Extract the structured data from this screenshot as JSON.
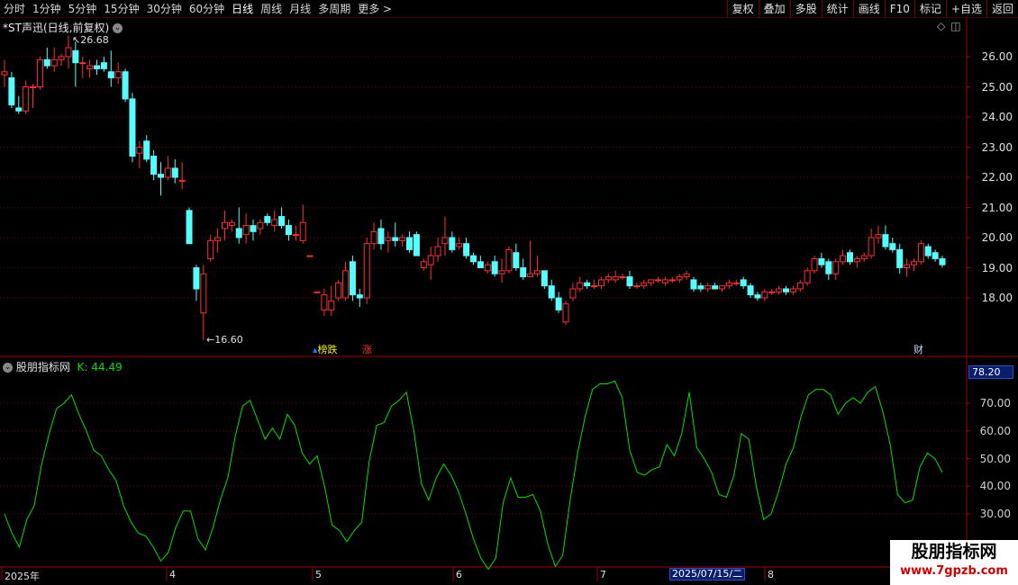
{
  "toolbar": {
    "periods": [
      "分时",
      "1分钟",
      "5分钟",
      "15分钟",
      "30分钟",
      "60分钟",
      "日线",
      "周线",
      "月线",
      "多周期",
      "更多 >"
    ],
    "active_period": "日线",
    "tools": [
      "复权",
      "叠加",
      "多股",
      "统计",
      "画线",
      "F10",
      "标记",
      "+自选",
      "返回"
    ]
  },
  "price_panel": {
    "title": "*ST声迅(日线,前复权)",
    "high_label": "26.68",
    "low_label": "16.60",
    "y_axis": [
      "26.00",
      "25.00",
      "24.00",
      "23.00",
      "22.00",
      "21.00",
      "20.00",
      "19.00",
      "18.00"
    ],
    "markers": [
      {
        "text": "榜跌",
        "color": "#f0f000"
      },
      {
        "text": "涨",
        "color": "#ff3030"
      },
      {
        "text": "财",
        "color": "#c0d8ff"
      }
    ],
    "icons": [
      "diamond-icon",
      "window-icon"
    ]
  },
  "oscillator": {
    "title": "股朋指标网",
    "series_label": "K: 44.49",
    "current_value": "78.20",
    "y_axis": [
      "70.00",
      "60.00",
      "50.00",
      "40.00",
      "30.00"
    ]
  },
  "x_axis": {
    "labels": [
      "2025年",
      "4",
      "5",
      "6",
      "7",
      "8"
    ],
    "cursor_date": "2025/07/15/二"
  },
  "watermark": {
    "title": "股朋指标网",
    "url": "www.7gpzb.com"
  },
  "chart_data": [
    {
      "type": "candlestick",
      "title": "*ST声迅(日线,前复权)",
      "ylim": [
        16.0,
        27.0
      ],
      "up_color": "#ff3030",
      "down_color": "#54ffff",
      "candles": [
        {
          "o": 25.4,
          "h": 25.9,
          "l": 25.0,
          "c": 25.5
        },
        {
          "o": 25.3,
          "h": 25.5,
          "l": 24.3,
          "c": 24.4
        },
        {
          "o": 24.3,
          "h": 24.7,
          "l": 24.1,
          "c": 24.2
        },
        {
          "o": 24.2,
          "h": 25.2,
          "l": 24.1,
          "c": 25.0
        },
        {
          "o": 25.0,
          "h": 25.1,
          "l": 24.3,
          "c": 25.0
        },
        {
          "o": 25.0,
          "h": 26.0,
          "l": 24.9,
          "c": 25.9
        },
        {
          "o": 25.9,
          "h": 26.3,
          "l": 25.6,
          "c": 25.7
        },
        {
          "o": 25.7,
          "h": 26.3,
          "l": 25.5,
          "c": 25.9
        },
        {
          "o": 25.9,
          "h": 26.1,
          "l": 25.7,
          "c": 26.0
        },
        {
          "o": 26.0,
          "h": 26.7,
          "l": 25.6,
          "c": 26.3
        },
        {
          "o": 26.2,
          "h": 26.5,
          "l": 25.0,
          "c": 25.8
        },
        {
          "o": 25.8,
          "h": 26.0,
          "l": 25.3,
          "c": 25.8
        },
        {
          "o": 25.6,
          "h": 25.9,
          "l": 25.3,
          "c": 25.7
        },
        {
          "o": 25.7,
          "h": 25.9,
          "l": 25.4,
          "c": 25.6
        },
        {
          "o": 25.8,
          "h": 26.0,
          "l": 25.5,
          "c": 25.6
        },
        {
          "o": 25.5,
          "h": 26.2,
          "l": 25.0,
          "c": 25.3
        },
        {
          "o": 25.3,
          "h": 25.8,
          "l": 25.1,
          "c": 25.5
        },
        {
          "o": 25.5,
          "h": 25.6,
          "l": 24.5,
          "c": 24.6
        },
        {
          "o": 24.6,
          "h": 24.8,
          "l": 22.5,
          "c": 22.7
        },
        {
          "o": 22.8,
          "h": 23.2,
          "l": 22.3,
          "c": 23.0
        },
        {
          "o": 23.2,
          "h": 23.4,
          "l": 22.5,
          "c": 22.6
        },
        {
          "o": 22.7,
          "h": 22.9,
          "l": 21.9,
          "c": 22.1
        },
        {
          "o": 22.1,
          "h": 22.5,
          "l": 21.4,
          "c": 22.0
        },
        {
          "o": 22.0,
          "h": 22.7,
          "l": 21.9,
          "c": 22.3
        },
        {
          "o": 22.3,
          "h": 22.6,
          "l": 21.8,
          "c": 22.0
        },
        {
          "o": 21.9,
          "h": 22.5,
          "l": 21.6,
          "c": 21.9
        },
        {
          "o": 20.9,
          "h": 21.0,
          "l": 19.8,
          "c": 19.8
        },
        {
          "o": 19.0,
          "h": 19.1,
          "l": 17.9,
          "c": 18.3
        },
        {
          "o": 17.5,
          "h": 19.1,
          "l": 16.6,
          "c": 18.8
        },
        {
          "o": 19.3,
          "h": 20.1,
          "l": 19.2,
          "c": 19.9
        },
        {
          "o": 19.9,
          "h": 20.3,
          "l": 19.5,
          "c": 20.0
        },
        {
          "o": 20.3,
          "h": 20.9,
          "l": 19.9,
          "c": 20.5
        },
        {
          "o": 20.4,
          "h": 20.6,
          "l": 20.2,
          "c": 20.5
        },
        {
          "o": 20.3,
          "h": 21.0,
          "l": 19.8,
          "c": 20.0
        },
        {
          "o": 20.1,
          "h": 20.8,
          "l": 19.8,
          "c": 20.4
        },
        {
          "o": 20.4,
          "h": 20.6,
          "l": 19.9,
          "c": 20.2
        },
        {
          "o": 20.3,
          "h": 20.6,
          "l": 20.1,
          "c": 20.5
        },
        {
          "o": 20.7,
          "h": 20.8,
          "l": 20.4,
          "c": 20.5
        },
        {
          "o": 20.4,
          "h": 20.9,
          "l": 20.2,
          "c": 20.6
        },
        {
          "o": 20.7,
          "h": 21.0,
          "l": 20.3,
          "c": 20.4
        },
        {
          "o": 20.4,
          "h": 20.6,
          "l": 19.9,
          "c": 20.1
        },
        {
          "o": 20.1,
          "h": 20.4,
          "l": 19.9,
          "c": 20.1
        },
        {
          "o": 19.9,
          "h": 21.1,
          "l": 19.8,
          "c": 20.5
        },
        {
          "o": 19.4,
          "h": 19.4,
          "l": 19.4,
          "c": 19.4
        },
        {
          "o": 18.2,
          "h": 18.2,
          "l": 18.2,
          "c": 18.2
        },
        {
          "o": 17.6,
          "h": 18.3,
          "l": 17.4,
          "c": 18.1
        },
        {
          "o": 17.6,
          "h": 18.4,
          "l": 17.4,
          "c": 17.9
        },
        {
          "o": 18.0,
          "h": 18.6,
          "l": 17.9,
          "c": 18.5
        },
        {
          "o": 18.0,
          "h": 19.2,
          "l": 17.9,
          "c": 18.9
        },
        {
          "o": 19.2,
          "h": 19.4,
          "l": 17.9,
          "c": 18.1
        },
        {
          "o": 18.1,
          "h": 18.3,
          "l": 17.7,
          "c": 18.0
        },
        {
          "o": 18.0,
          "h": 20.0,
          "l": 17.8,
          "c": 19.8
        },
        {
          "o": 19.8,
          "h": 20.5,
          "l": 19.6,
          "c": 20.2
        },
        {
          "o": 20.3,
          "h": 20.6,
          "l": 19.6,
          "c": 19.8
        },
        {
          "o": 19.9,
          "h": 20.2,
          "l": 19.5,
          "c": 20.0
        },
        {
          "o": 20.0,
          "h": 20.5,
          "l": 19.7,
          "c": 19.9
        },
        {
          "o": 19.9,
          "h": 20.1,
          "l": 19.7,
          "c": 20.0
        },
        {
          "o": 20.0,
          "h": 20.2,
          "l": 19.5,
          "c": 19.6
        },
        {
          "o": 20.1,
          "h": 20.2,
          "l": 19.4,
          "c": 19.4
        },
        {
          "o": 19.0,
          "h": 19.3,
          "l": 18.9,
          "c": 19.2
        },
        {
          "o": 19.1,
          "h": 19.7,
          "l": 18.6,
          "c": 19.4
        },
        {
          "o": 19.4,
          "h": 20.0,
          "l": 19.2,
          "c": 19.7
        },
        {
          "o": 19.8,
          "h": 20.7,
          "l": 19.4,
          "c": 20.0
        },
        {
          "o": 20.0,
          "h": 20.2,
          "l": 19.5,
          "c": 19.6
        },
        {
          "o": 19.7,
          "h": 20.0,
          "l": 19.6,
          "c": 19.8
        },
        {
          "o": 19.8,
          "h": 20.0,
          "l": 19.3,
          "c": 19.4
        },
        {
          "o": 19.4,
          "h": 19.5,
          "l": 19.1,
          "c": 19.2
        },
        {
          "o": 19.2,
          "h": 19.4,
          "l": 19.0,
          "c": 19.0
        },
        {
          "o": 18.9,
          "h": 19.2,
          "l": 18.8,
          "c": 19.1
        },
        {
          "o": 19.2,
          "h": 19.4,
          "l": 18.7,
          "c": 18.8
        },
        {
          "o": 18.8,
          "h": 19.3,
          "l": 18.5,
          "c": 18.9
        },
        {
          "o": 18.9,
          "h": 19.7,
          "l": 18.8,
          "c": 19.6
        },
        {
          "o": 19.5,
          "h": 19.8,
          "l": 18.9,
          "c": 19.0
        },
        {
          "o": 19.0,
          "h": 19.3,
          "l": 18.6,
          "c": 18.7
        },
        {
          "o": 18.7,
          "h": 19.9,
          "l": 18.7,
          "c": 18.8
        },
        {
          "o": 18.8,
          "h": 19.4,
          "l": 18.7,
          "c": 18.9
        },
        {
          "o": 18.9,
          "h": 18.9,
          "l": 18.3,
          "c": 18.4
        },
        {
          "o": 18.4,
          "h": 18.6,
          "l": 17.9,
          "c": 18.0
        },
        {
          "o": 18.0,
          "h": 18.2,
          "l": 17.5,
          "c": 17.6
        },
        {
          "o": 17.2,
          "h": 17.9,
          "l": 17.1,
          "c": 17.8
        },
        {
          "o": 18.0,
          "h": 18.5,
          "l": 17.9,
          "c": 18.3
        },
        {
          "o": 18.3,
          "h": 18.7,
          "l": 18.2,
          "c": 18.5
        },
        {
          "o": 18.5,
          "h": 18.6,
          "l": 18.3,
          "c": 18.4
        },
        {
          "o": 18.4,
          "h": 18.6,
          "l": 18.3,
          "c": 18.4
        },
        {
          "o": 18.4,
          "h": 18.7,
          "l": 18.3,
          "c": 18.6
        },
        {
          "o": 18.6,
          "h": 18.8,
          "l": 18.5,
          "c": 18.7
        },
        {
          "o": 18.6,
          "h": 18.9,
          "l": 18.5,
          "c": 18.7
        },
        {
          "o": 18.7,
          "h": 18.8,
          "l": 18.6,
          "c": 18.7
        },
        {
          "o": 18.7,
          "h": 18.9,
          "l": 18.3,
          "c": 18.4
        },
        {
          "o": 18.4,
          "h": 18.5,
          "l": 18.3,
          "c": 18.4
        },
        {
          "o": 18.4,
          "h": 18.6,
          "l": 18.3,
          "c": 18.5
        },
        {
          "o": 18.5,
          "h": 18.6,
          "l": 18.4,
          "c": 18.6
        },
        {
          "o": 18.6,
          "h": 18.7,
          "l": 18.5,
          "c": 18.6
        },
        {
          "o": 18.5,
          "h": 18.7,
          "l": 18.4,
          "c": 18.6
        },
        {
          "o": 18.6,
          "h": 18.7,
          "l": 18.5,
          "c": 18.6
        },
        {
          "o": 18.6,
          "h": 18.8,
          "l": 18.5,
          "c": 18.7
        },
        {
          "o": 18.7,
          "h": 18.9,
          "l": 18.6,
          "c": 18.8
        },
        {
          "o": 18.6,
          "h": 18.7,
          "l": 18.2,
          "c": 18.3
        },
        {
          "o": 18.4,
          "h": 18.5,
          "l": 18.2,
          "c": 18.3
        },
        {
          "o": 18.3,
          "h": 18.5,
          "l": 18.2,
          "c": 18.4
        },
        {
          "o": 18.4,
          "h": 18.5,
          "l": 18.3,
          "c": 18.3
        },
        {
          "o": 18.3,
          "h": 18.4,
          "l": 18.2,
          "c": 18.4
        },
        {
          "o": 18.4,
          "h": 18.6,
          "l": 18.3,
          "c": 18.5
        },
        {
          "o": 18.5,
          "h": 18.6,
          "l": 18.4,
          "c": 18.5
        },
        {
          "o": 18.6,
          "h": 18.7,
          "l": 18.3,
          "c": 18.4
        },
        {
          "o": 18.4,
          "h": 18.5,
          "l": 18.0,
          "c": 18.1
        },
        {
          "o": 18.1,
          "h": 18.2,
          "l": 17.9,
          "c": 18.0
        },
        {
          "o": 18.0,
          "h": 18.3,
          "l": 17.9,
          "c": 18.2
        },
        {
          "o": 18.2,
          "h": 18.3,
          "l": 18.1,
          "c": 18.2
        },
        {
          "o": 18.2,
          "h": 18.4,
          "l": 18.1,
          "c": 18.3
        },
        {
          "o": 18.3,
          "h": 18.4,
          "l": 18.1,
          "c": 18.2
        },
        {
          "o": 18.2,
          "h": 18.4,
          "l": 18.1,
          "c": 18.3
        },
        {
          "o": 18.3,
          "h": 18.6,
          "l": 18.2,
          "c": 18.5
        },
        {
          "o": 18.5,
          "h": 19.0,
          "l": 18.4,
          "c": 18.9
        },
        {
          "o": 18.9,
          "h": 19.4,
          "l": 18.8,
          "c": 19.3
        },
        {
          "o": 19.3,
          "h": 19.5,
          "l": 19.0,
          "c": 19.1
        },
        {
          "o": 19.2,
          "h": 19.3,
          "l": 18.6,
          "c": 18.8
        },
        {
          "o": 18.8,
          "h": 19.3,
          "l": 18.6,
          "c": 19.2
        },
        {
          "o": 19.2,
          "h": 19.6,
          "l": 19.1,
          "c": 19.4
        },
        {
          "o": 19.5,
          "h": 19.6,
          "l": 19.1,
          "c": 19.2
        },
        {
          "o": 19.2,
          "h": 19.4,
          "l": 19.0,
          "c": 19.3
        },
        {
          "o": 19.3,
          "h": 19.5,
          "l": 19.2,
          "c": 19.4
        },
        {
          "o": 19.4,
          "h": 20.3,
          "l": 19.3,
          "c": 20.0
        },
        {
          "o": 20.0,
          "h": 20.4,
          "l": 19.8,
          "c": 20.1
        },
        {
          "o": 20.1,
          "h": 20.4,
          "l": 19.6,
          "c": 19.7
        },
        {
          "o": 19.8,
          "h": 20.0,
          "l": 19.5,
          "c": 19.6
        },
        {
          "o": 19.6,
          "h": 19.8,
          "l": 18.8,
          "c": 19.0
        },
        {
          "o": 19.0,
          "h": 19.3,
          "l": 18.7,
          "c": 19.1
        },
        {
          "o": 19.1,
          "h": 19.3,
          "l": 18.9,
          "c": 19.2
        },
        {
          "o": 19.2,
          "h": 19.9,
          "l": 19.1,
          "c": 19.8
        },
        {
          "o": 19.7,
          "h": 19.8,
          "l": 19.3,
          "c": 19.4
        },
        {
          "o": 19.5,
          "h": 19.6,
          "l": 19.2,
          "c": 19.3
        },
        {
          "o": 19.3,
          "h": 19.4,
          "l": 19.0,
          "c": 19.1
        }
      ]
    },
    {
      "type": "line",
      "title": "股朋指标网",
      "series": [
        {
          "name": "K",
          "color": "#00e000",
          "values": [
            30,
            23,
            18,
            28,
            33,
            48,
            59,
            68,
            70,
            73,
            66,
            60,
            53,
            51,
            46,
            42,
            33,
            27,
            23,
            22,
            18,
            13,
            16,
            25,
            31,
            31,
            21,
            17,
            25,
            35,
            43,
            58,
            69,
            71,
            64,
            57,
            61,
            57,
            66,
            62,
            52,
            48,
            51,
            40,
            26,
            24,
            20,
            24,
            27,
            49,
            62,
            63,
            69,
            71,
            74,
            60,
            41,
            35,
            43,
            48,
            44,
            38,
            30,
            21,
            14,
            10,
            14,
            34,
            43,
            36,
            36,
            37,
            31,
            19,
            11,
            15,
            35,
            52,
            65,
            75,
            77,
            77,
            78,
            72,
            53,
            45,
            44,
            46,
            47,
            55,
            51,
            59,
            74,
            54,
            50,
            45,
            37,
            36,
            44,
            59,
            57,
            40,
            28,
            30,
            38,
            48,
            54,
            65,
            73,
            75,
            75,
            73,
            66,
            70,
            72,
            70,
            74,
            76,
            67,
            55,
            37,
            34,
            35,
            47,
            52,
            50,
            45
          ]
        }
      ],
      "ylim": [
        25,
        82
      ]
    }
  ]
}
